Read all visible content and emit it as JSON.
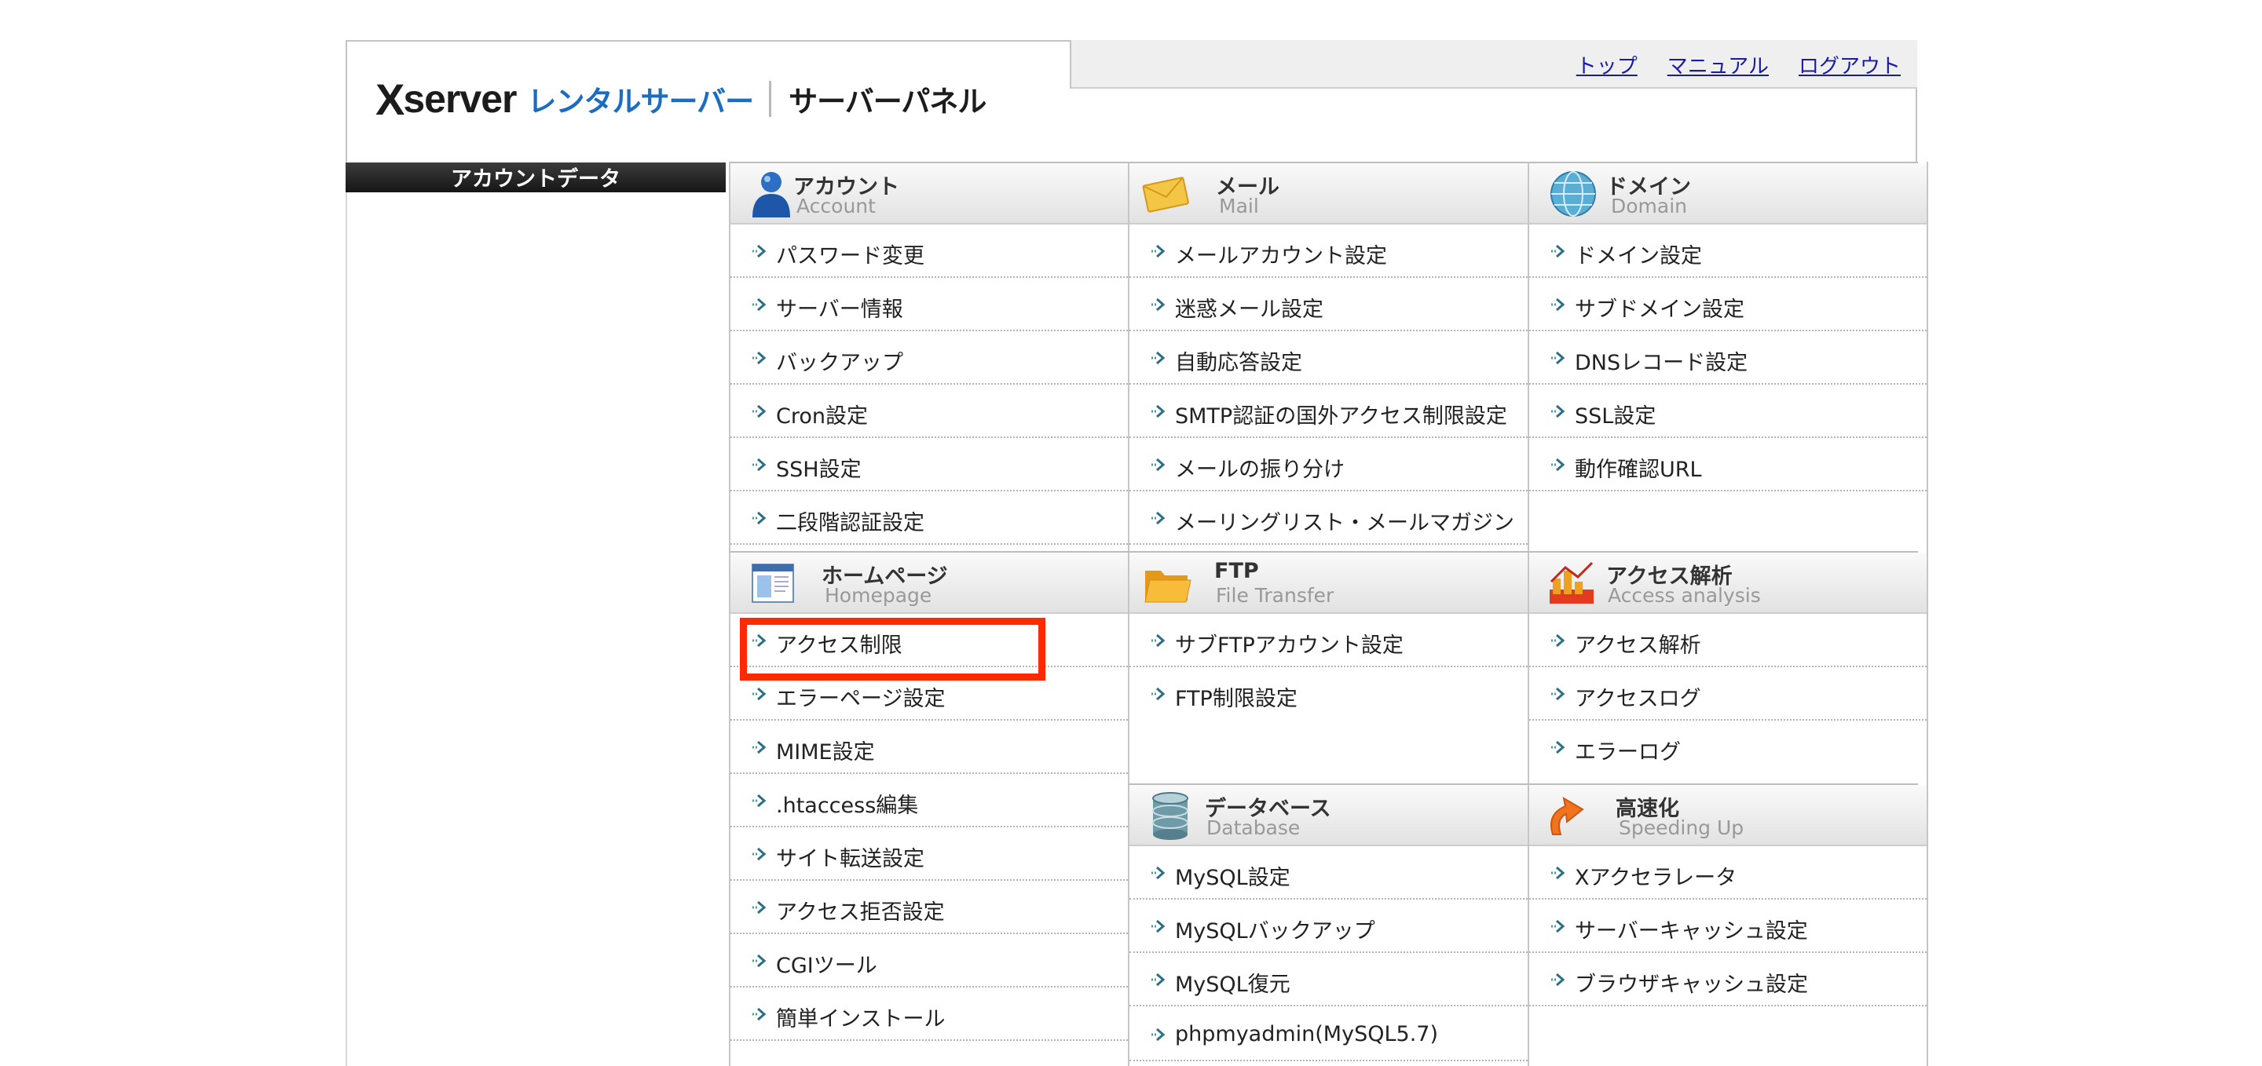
{
  "header": {
    "logo": {
      "mark": "X",
      "server": "server",
      "rental": "レンタルサーバー",
      "panel": "サーバーパネル"
    },
    "links": [
      {
        "label": "トップ"
      },
      {
        "label": "マニュアル"
      },
      {
        "label": "ログアウト"
      }
    ]
  },
  "sidebar": {
    "title": "アカウントデータ"
  },
  "sections": {
    "account": {
      "title": "アカウント",
      "subtitle": "Account",
      "icon": "user-icon",
      "items": [
        "パスワード変更",
        "サーバー情報",
        "バックアップ",
        "Cron設定",
        "SSH設定",
        "二段階認証設定"
      ]
    },
    "mail": {
      "title": "メール",
      "subtitle": "Mail",
      "icon": "envelope-icon",
      "items": [
        "メールアカウント設定",
        "迷惑メール設定",
        "自動応答設定",
        "SMTP認証の国外アクセス制限設定",
        "メールの振り分け",
        "メーリングリスト・メールマガジン"
      ]
    },
    "domain": {
      "title": "ドメイン",
      "subtitle": "Domain",
      "icon": "globe-icon",
      "items": [
        "ドメイン設定",
        "サブドメイン設定",
        "DNSレコード設定",
        "SSL設定",
        "動作確認URL"
      ]
    },
    "homepage": {
      "title": "ホームページ",
      "subtitle": "Homepage",
      "icon": "webpage-icon",
      "items": [
        "アクセス制限",
        "エラーページ設定",
        "MIME設定",
        ".htaccess編集",
        "サイト転送設定",
        "アクセス拒否設定",
        "CGIツール",
        "簡単インストール"
      ]
    },
    "ftp": {
      "title": "FTP",
      "subtitle": "File Transfer",
      "icon": "folder-icon",
      "items": [
        "サブFTPアカウント設定",
        "FTP制限設定"
      ]
    },
    "access_analysis": {
      "title": "アクセス解析",
      "subtitle": "Access analysis",
      "icon": "bar-chart-icon",
      "items": [
        "アクセス解析",
        "アクセスログ",
        "エラーログ"
      ]
    },
    "database": {
      "title": "データベース",
      "subtitle": "Database",
      "icon": "database-icon",
      "items": [
        "MySQL設定",
        "MySQLバックアップ",
        "MySQL復元",
        "phpmyadmin(MySQL5.7)"
      ]
    },
    "speed": {
      "title": "高速化",
      "subtitle": "Speeding Up",
      "icon": "speed-arrow-icon",
      "items": [
        "Xアクセラレータ",
        "サーバーキャッシュ設定",
        "ブラウザキャッシュ設定"
      ]
    }
  },
  "highlight": {
    "color": "#ff2a00",
    "target": "アクセス制限"
  }
}
